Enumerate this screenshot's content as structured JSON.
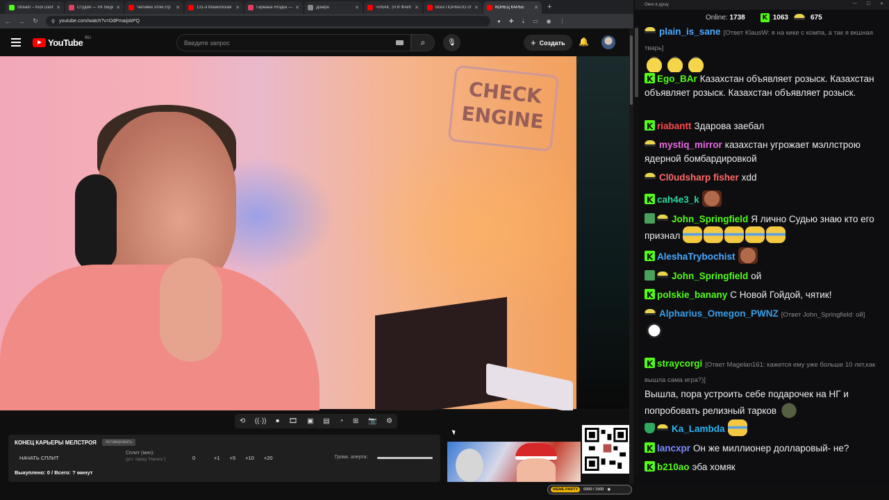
{
  "browser": {
    "tabs": [
      {
        "label": "Stream – Kick Dash",
        "color": "#53fc18"
      },
      {
        "label": "Студия — VK Видео",
        "color": "#e04060"
      },
      {
        "label": "Человек этом стр",
        "color": "#ff0000"
      },
      {
        "label": "131-я Майкопская",
        "color": "#ff0000"
      },
      {
        "label": "Германа Ягодка —",
        "color": "#e04060"
      },
      {
        "label": "Дiaйра",
        "color": "#888888"
      },
      {
        "label": "ЧУВАК, ЭТИ ФАЙЛ",
        "color": "#ff0000"
      },
      {
        "label": "Всех ПОРВАЛО от",
        "color": "#ff0000"
      },
      {
        "label": "КОНЕЦ КАРЬЕ",
        "color": "#ff0000",
        "active": true
      }
    ],
    "url": "youtube.com/watch?v=OdPmaijskPQ"
  },
  "youtube": {
    "logo_text": "YouTube",
    "logo_region": "RU",
    "search_placeholder": "Введите запрос",
    "create_label": "Создать"
  },
  "video": {
    "sign_text": "CHECK ENGINE"
  },
  "alert_panel": {
    "title": "КОНЕЦ КАРЬЕРЫ МЕЛСТРОЯ",
    "badge": "Активировать",
    "start_label": "НАЧАТЬ СПЛИТ",
    "split_label": "Сплит (мин):",
    "split_hint": "(уст. перед \"Начать\")",
    "split_value": "0",
    "increments": [
      "+1",
      "+5",
      "+10",
      "+20"
    ],
    "volume_label": "Громк. алерта:",
    "volume_level": 1.0,
    "bought": "Выкуплено: 0 / Всего: ? минут"
  },
  "meme_bar": {
    "label": "MEME PARTY",
    "count": "0000 / 1500"
  },
  "chat": {
    "window_title": "Окно в душу",
    "online_label": "Online:",
    "online_count": "1738",
    "kick_count": "1063",
    "yellow_count": "675",
    "messages": [
      {
        "badges": [
          "glasses"
        ],
        "user": "plain_is_sane",
        "user_color": "#4aa8ff",
        "reply": "[Ответ KlausW: я на кике с компа, а так я вкшная тварь]",
        "text": "",
        "emotes": [
          "glasses",
          "glasses",
          "glasses"
        ]
      },
      {
        "badges": [
          "kick"
        ],
        "user": "Ego_BAr",
        "user_color": "#53fc18",
        "reply": "",
        "text": "Казахстан объявляет розыск. Казахстан объявляет розыск. Казахстан объявляет розыск.",
        "emotes": []
      },
      {
        "badges": [
          "kick"
        ],
        "user": "riabantt",
        "user_color": "#ff4a4a",
        "reply": "",
        "text": "Здарова заебал",
        "emotes": []
      },
      {
        "badges": [
          "glasses"
        ],
        "user": "mystiq_mirror",
        "user_color": "#e86ae0",
        "reply": "",
        "text": "казахстан угрожает мэллстрою ядерной бомбардировкой",
        "emotes": []
      },
      {
        "badges": [
          "glasses"
        ],
        "user": "Cl0udsharp fisher",
        "user_color": "#ff6a6a",
        "reply": "",
        "text": "xdd",
        "emotes": []
      },
      {
        "badges": [
          "kick"
        ],
        "user": "cah4e3_k",
        "user_color": "#29d6a0",
        "reply": "",
        "text": "",
        "emotes": [
          "face"
        ]
      },
      {
        "badges": [
          "pencil",
          "glasses"
        ],
        "user": "John_Springfield",
        "user_color": "#53fc18",
        "reply": "",
        "text": "Я лично Судью знаю кто его признал",
        "emotes": [
          "lol",
          "lol",
          "lol",
          "lol",
          "lol"
        ]
      },
      {
        "badges": [
          "kick"
        ],
        "user": "AleshaTrybochist",
        "user_color": "#4aa8ff",
        "reply": "",
        "text": "",
        "emotes": [
          "face"
        ]
      },
      {
        "badges": [
          "pencil",
          "glasses"
        ],
        "user": "John_Springfield",
        "user_color": "#53fc18",
        "reply": "",
        "text": "ой",
        "emotes": []
      },
      {
        "badges": [
          "kick"
        ],
        "user": "polskie_banany",
        "user_color": "#53fc18",
        "reply": "",
        "text": "С Новой Гойдой, чятик!",
        "emotes": []
      },
      {
        "badges": [
          "glasses"
        ],
        "user": "Alpharius_Omegon_PWNZ",
        "user_color": "#3a9ee6",
        "reply": "[Ответ John_Springfield: ой]",
        "text": "",
        "emotes": [
          "joker"
        ]
      },
      {
        "badges": [
          "kick"
        ],
        "user": "straycorgi",
        "user_color": "#53fc18",
        "reply": "[Ответ Magelan161: кажется ему уже больше 10 лет,как вышла сама игра?)]",
        "text": "Вышла, пора устроить себе подарочек на НГ и попробовать релизный тарков",
        "emotes": [
          "frog"
        ]
      },
      {
        "badges": [
          "shield",
          "glasses"
        ],
        "user": "Ka_Lambda",
        "user_color": "#29b6f6",
        "reply": "",
        "text": "",
        "emotes": [
          "lol"
        ]
      },
      {
        "badges": [
          "kick"
        ],
        "user": "lancxpr",
        "user_color": "#7c8cff",
        "reply": "",
        "text": "Он же миллионер долларовый- не?",
        "emotes": []
      },
      {
        "badges": [
          "kick"
        ],
        "user": "b210ao",
        "user_color": "#53fc18",
        "reply": "",
        "text": "эба хомяк",
        "emotes": []
      }
    ]
  }
}
